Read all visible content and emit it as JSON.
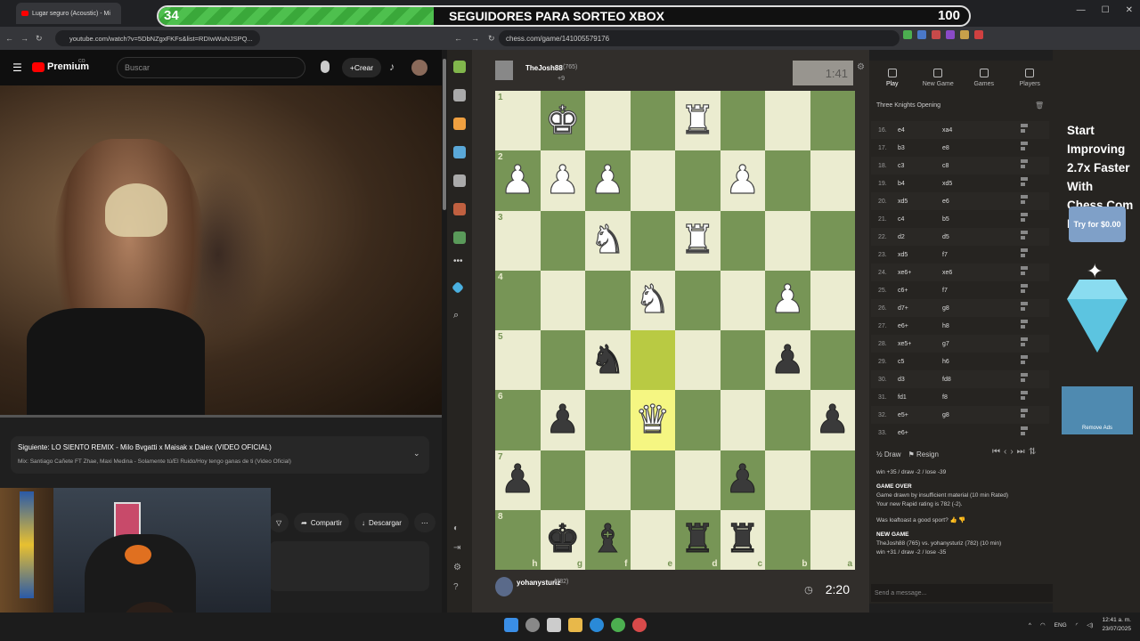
{
  "left_browser": {
    "tab_title": "Lugar seguro (Acoustic) - Mi",
    "url": "youtube.com/watch?v=5DbNZgxFKFs&list=RDIwWuNJSPQ...",
    "youtube": {
      "brand": "Premium",
      "brand_sup": "CO",
      "search_placeholder": "Buscar",
      "create_label": "Crear",
      "next_title": "Siguiente: LO SIENTO REMIX - Milo Bvgatti x Maisak x Dalex (VIDEO OFICIAL)",
      "next_sub": "Mix: Santiago Cañete FT Zhae, Maxi Medina - Solamente tú/El Ruido/Hoy tengo ganas de ti (Video Oficial)",
      "share_label": "Compartir",
      "download_label": "Descargar"
    }
  },
  "overlay": {
    "current": "34",
    "title": "SEGUIDORES PARA SORTEO XBOX",
    "goal": "100",
    "progress": 0.34
  },
  "right_browser": {
    "url": "chess.com/game/141005579176"
  },
  "chess": {
    "top_player": {
      "name": "TheJosh88",
      "rating": "(765)",
      "extra": "+9",
      "clock": "1:41"
    },
    "bottom_player": {
      "name": "yohanysturiz",
      "rating": "(782)",
      "clock": "2:20"
    },
    "ranks": [
      "1",
      "2",
      "3",
      "4",
      "5",
      "6",
      "7",
      "8"
    ],
    "files": [
      "h",
      "g",
      "f",
      "e",
      "d",
      "c",
      "b",
      "a"
    ],
    "board": [
      [
        "",
        "wK",
        "",
        "",
        "wR",
        "",
        "",
        ""
      ],
      [
        "wP",
        "wP",
        "wP",
        "",
        "",
        "wP",
        "",
        ""
      ],
      [
        "",
        "",
        "wN",
        "",
        "wR",
        "",
        "",
        ""
      ],
      [
        "",
        "",
        "",
        "wN",
        "",
        "",
        "wP",
        ""
      ],
      [
        "",
        "",
        "bN",
        "",
        "",
        "",
        "bP",
        ""
      ],
      [
        "",
        "bP",
        "",
        "wQ",
        "",
        "",
        "",
        "bP"
      ],
      [
        "bP",
        "",
        "",
        "",
        "",
        "bP",
        "",
        ""
      ],
      [
        "",
        "bK",
        "bB",
        "",
        "bR",
        "bR",
        "",
        ""
      ]
    ],
    "highlights": [
      [
        4,
        3
      ],
      [
        5,
        3
      ]
    ],
    "tabs": [
      "Play",
      "New Game",
      "Games",
      "Players"
    ],
    "opening": "Three Knights Opening",
    "moves": [
      {
        "n": "16.",
        "w": "e4",
        "b": "xa4"
      },
      {
        "n": "17.",
        "w": "b3",
        "b": "e8"
      },
      {
        "n": "18.",
        "w": "c3",
        "b": "c8"
      },
      {
        "n": "19.",
        "w": "b4",
        "b": "xd5"
      },
      {
        "n": "20.",
        "w": "xd5",
        "b": "e6"
      },
      {
        "n": "21.",
        "w": "c4",
        "b": "b5"
      },
      {
        "n": "22.",
        "w": "d2",
        "b": "d5"
      },
      {
        "n": "23.",
        "w": "xd5",
        "b": "f7"
      },
      {
        "n": "24.",
        "w": "xe6+",
        "b": "xe6"
      },
      {
        "n": "25.",
        "w": "c6+",
        "b": "f7"
      },
      {
        "n": "26.",
        "w": "d7+",
        "b": "g8"
      },
      {
        "n": "27.",
        "w": "e6+",
        "b": "h8"
      },
      {
        "n": "28.",
        "w": "xe5+",
        "b": "g7"
      },
      {
        "n": "29.",
        "w": "c5",
        "b": "h6"
      },
      {
        "n": "30.",
        "w": "d3",
        "b": "fd8"
      },
      {
        "n": "31.",
        "w": "fd1",
        "b": "f8"
      },
      {
        "n": "32.",
        "w": "e5+",
        "b": "g8"
      },
      {
        "n": "33.",
        "w": "e6+",
        "b": ""
      }
    ],
    "draw_label": "Draw",
    "resign_label": "Resign",
    "log": {
      "stats1": "win +35 / draw -2 / lose -39",
      "game_over": "GAME OVER",
      "result": "Game drawn by insufficient material (10 min Rated)",
      "rating": "Your new Rapid rating is 782 (-2).",
      "question": "Was loaftoast a good sport?",
      "new_game": "NEW GAME",
      "matchup": "TheJosh88 (765) vs. yohanysturiz (782) (10 min)",
      "stats2": "win +31 / draw -2 / lose -35"
    },
    "message_placeholder": "Send a message..."
  },
  "ad": {
    "headline": "Start Improving 2.7x Faster With Chess.Com Premium",
    "cta": "Try for $0.00",
    "remove": "Remove Ads"
  },
  "taskbar": {
    "lang": "ENG",
    "time": "12:41 a. m.",
    "date": "23/07/2025"
  }
}
